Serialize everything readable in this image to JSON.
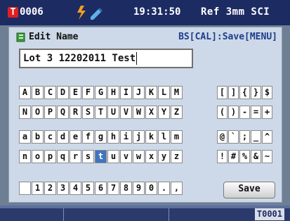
{
  "status_bar": {
    "sample_id": "0006",
    "badge_letter": "T",
    "time": "19:31:50",
    "ref_info": "Ref 3mm SCI"
  },
  "dialog": {
    "title": "Edit Name",
    "hint": "BS[CAL]:Save[MENU]",
    "name_value": "Lot 3 12202011 Test",
    "save_label": "Save",
    "selected_key": "t"
  },
  "keyboard": {
    "upper_row1": [
      "A",
      "B",
      "C",
      "D",
      "E",
      "F",
      "G",
      "H",
      "I",
      "J",
      "K",
      "L",
      "M"
    ],
    "upper_row2": [
      "N",
      "O",
      "P",
      "Q",
      "R",
      "S",
      "T",
      "U",
      "V",
      "W",
      "X",
      "Y",
      "Z"
    ],
    "lower_row1": [
      "a",
      "b",
      "c",
      "d",
      "e",
      "f",
      "g",
      "h",
      "i",
      "j",
      "k",
      "l",
      "m"
    ],
    "lower_row2": [
      "n",
      "o",
      "p",
      "q",
      "r",
      "s",
      "t",
      "u",
      "v",
      "w",
      "x",
      "y",
      "z"
    ],
    "digits_row": [
      " ",
      "1",
      "2",
      "3",
      "4",
      "5",
      "6",
      "7",
      "8",
      "9",
      "0",
      ".",
      ","
    ],
    "sym_row1": [
      "[",
      "]",
      "{",
      "}",
      "$"
    ],
    "sym_row2": [
      "(",
      ")",
      "-",
      "=",
      "+"
    ],
    "sym_row3": [
      "@",
      "`",
      ";",
      "_",
      "^"
    ],
    "sym_row4": [
      "!",
      "#",
      "%",
      "&",
      "~"
    ]
  },
  "footer": {
    "tag_code": "T0001"
  },
  "colors": {
    "header_bg": "#1d2b63",
    "panel_bg": "#cdd9e8",
    "accent_red": "#e02020",
    "selected_key_bg": "#3f74c0",
    "hint_text": "#1d3c8c"
  },
  "icons": [
    "lightning-bolt-icon",
    "pencil-icon",
    "notebook-icon"
  ]
}
